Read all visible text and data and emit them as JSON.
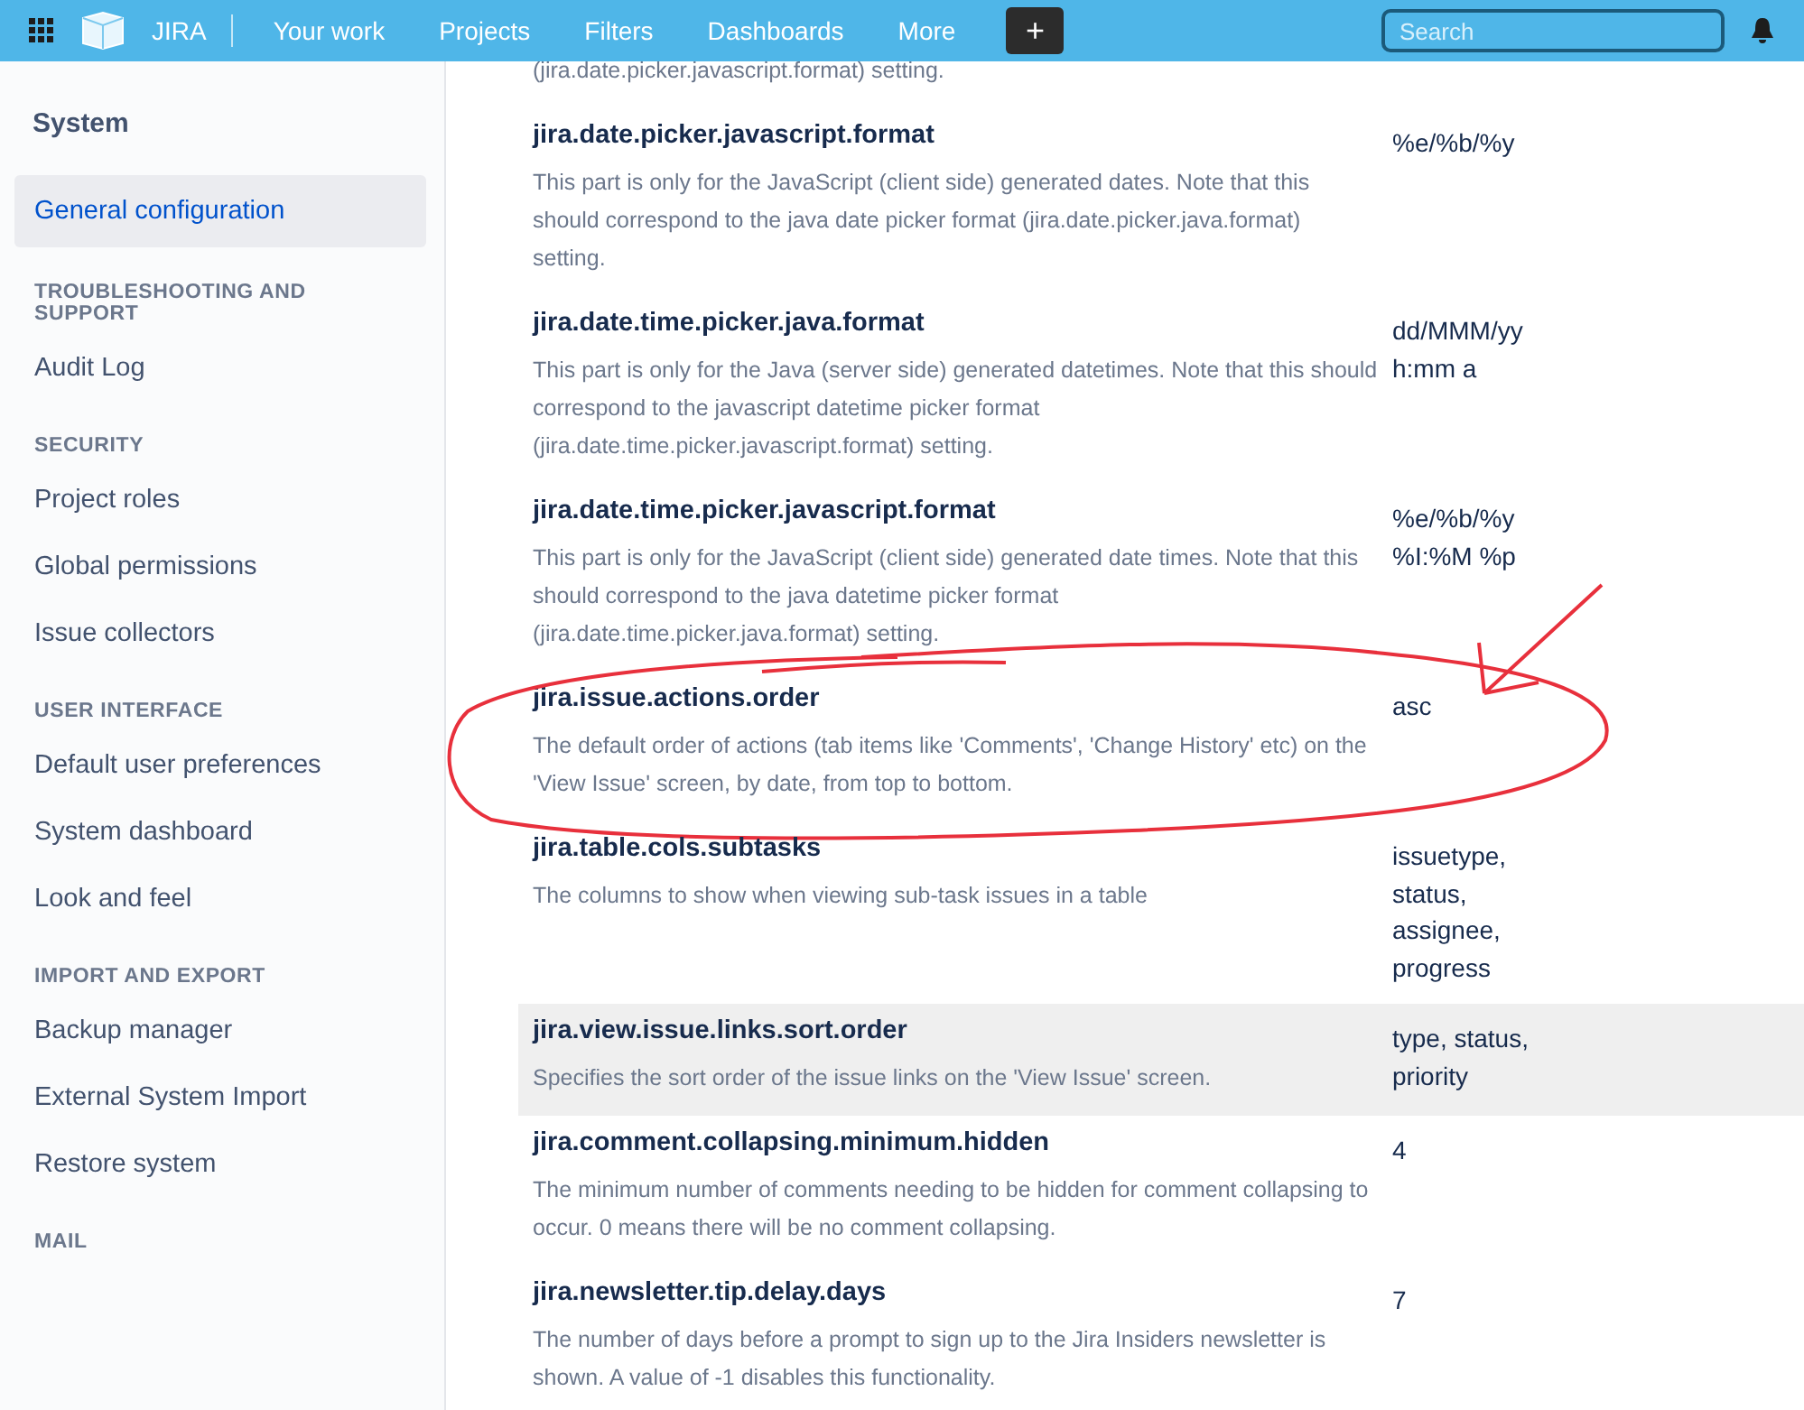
{
  "header": {
    "product": "JIRA",
    "nav": [
      {
        "label": "Your work"
      },
      {
        "label": "Projects"
      },
      {
        "label": "Filters"
      },
      {
        "label": "Dashboards"
      },
      {
        "label": "More"
      }
    ],
    "create": "+",
    "search": {
      "placeholder": "Search"
    }
  },
  "sidebar": {
    "title": "System",
    "items": [
      {
        "kind": "item",
        "label": "General configuration",
        "selected": true
      },
      {
        "kind": "heading",
        "label": "TROUBLESHOOTING AND SUPPORT"
      },
      {
        "kind": "item",
        "label": "Audit Log",
        "selected": false
      },
      {
        "kind": "heading",
        "label": "SECURITY"
      },
      {
        "kind": "item",
        "label": "Project roles",
        "selected": false
      },
      {
        "kind": "item",
        "label": "Global permissions",
        "selected": false
      },
      {
        "kind": "item",
        "label": "Issue collectors",
        "selected": false
      },
      {
        "kind": "heading",
        "label": "USER INTERFACE"
      },
      {
        "kind": "item",
        "label": "Default user preferences",
        "selected": false
      },
      {
        "kind": "item",
        "label": "System dashboard",
        "selected": false
      },
      {
        "kind": "item",
        "label": "Look and feel",
        "selected": false
      },
      {
        "kind": "heading",
        "label": "IMPORT AND EXPORT"
      },
      {
        "kind": "item",
        "label": "Backup manager",
        "selected": false
      },
      {
        "kind": "item",
        "label": "External System Import",
        "selected": false
      },
      {
        "kind": "item",
        "label": "Restore system",
        "selected": false
      },
      {
        "kind": "heading",
        "label": "MAIL"
      }
    ]
  },
  "settings": {
    "continued_text": "(jira.date.picker.javascript.format) setting.",
    "rows": [
      {
        "key": "jira.date.picker.javascript.format",
        "description": "This part is only for the JavaScript (client side) generated dates. Note that this should correspond to the java date picker format (jira.date.picker.java.format) setting.",
        "value": [
          "%e/%b/%y"
        ],
        "highlighted": false,
        "circled": false
      },
      {
        "key": "jira.date.time.picker.java.format",
        "description": "This part is only for the Java (server side) generated datetimes. Note that this should correspond to the javascript datetime picker format (jira.date.time.picker.javascript.format) setting.",
        "value": [
          "dd/MMM/yy",
          "h:mm a"
        ],
        "highlighted": false,
        "circled": false
      },
      {
        "key": "jira.date.time.picker.javascript.format",
        "description": "This part is only for the JavaScript (client side) generated date times. Note that this should correspond to the java datetime picker format (jira.date.time.picker.java.format) setting.",
        "value": [
          "%e/%b/%y",
          "%I:%M %p"
        ],
        "highlighted": false,
        "circled": false
      },
      {
        "key": "jira.issue.actions.order",
        "description": "The default order of actions (tab items like 'Comments', 'Change History' etc) on the 'View Issue' screen, by date, from top to bottom.",
        "value": [
          "asc"
        ],
        "highlighted": false,
        "circled": true
      },
      {
        "key": "jira.table.cols.subtasks",
        "description": "The columns to show when viewing sub-task issues in a table",
        "value": [
          "issuetype,",
          "status,",
          "assignee,",
          "progress"
        ],
        "highlighted": false,
        "circled": false
      },
      {
        "key": "jira.view.issue.links.sort.order",
        "description": "Specifies the sort order of the issue links on the 'View Issue' screen.",
        "value": [
          "type, status,",
          "priority"
        ],
        "highlighted": true,
        "circled": false
      },
      {
        "key": "jira.comment.collapsing.minimum.hidden",
        "description": "The minimum number of comments needing to be hidden for comment collapsing to occur. 0 means there will be no comment collapsing.",
        "value": [
          "4"
        ],
        "highlighted": false,
        "circled": false
      },
      {
        "key": "jira.newsletter.tip.delay.days",
        "description": "The number of days before a prompt to sign up to the Jira Insiders newsletter is shown. A value of -1 disables this functionality.",
        "value": [
          "7"
        ],
        "highlighted": false,
        "circled": false
      }
    ]
  }
}
